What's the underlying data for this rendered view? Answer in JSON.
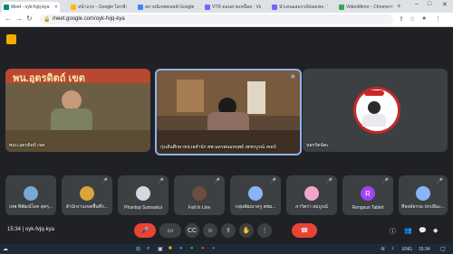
{
  "browser": {
    "tabs": [
      {
        "title": "Meet - oyk-fvjq-kya",
        "fav": "#00897b",
        "active": true
      },
      {
        "title": "หน้าแรก - Google ไดรฟ์",
        "fav": "#fbbc04",
        "active": false
      },
      {
        "title": "สถานนิเทศคอมพ์ Google",
        "fav": "#4285f4",
        "active": false
      },
      {
        "title": "VTR ดอนย่ายเหนื่อย - Video",
        "fav": "#7b61ff",
        "active": false
      },
      {
        "title": "นำเสนอสมรรถ์ย่อยเพจ - Video",
        "fav": "#7b61ff",
        "active": false
      },
      {
        "title": "VideoMirror - Chrome",
        "fav": "#34a853",
        "active": false
      }
    ],
    "url": "meet.google.com/oyk-fvjq-kya",
    "window_controls": [
      "–",
      "□",
      "✕"
    ]
  },
  "meet": {
    "main_tiles": [
      {
        "name": "พนบ.อุตรดิตถ์ เขต",
        "banner": "พน.อุตรดิตถ์ เขต"
      },
      {
        "name": "กุ่งเส้นศึกษาหน่วยสำนัก ศพ.นครพนมหฤพธ์ เพชรบูรณ์ เขต3"
      },
      {
        "name": "นพรรัตน์ตะ"
      }
    ],
    "bottom_tiles": [
      {
        "name": "เทพ พิพัฒน์โยค สุดๆ...",
        "avatar_color": "#7aa7d6",
        "letter": ""
      },
      {
        "name": "สำนักงานเขตพื้นที่ก...",
        "avatar_color": "#d9a43b",
        "letter": ""
      },
      {
        "name": "Phanlop Sumsakul",
        "avatar_color": "#cfd8e3",
        "letter": ""
      },
      {
        "name": "Fall In Line",
        "avatar_color": "#6d4c41",
        "letter": ""
      },
      {
        "name": "กลุ่มพัฒนาครู สพม...",
        "avatar_color": "#8ab4f8",
        "letter": ""
      },
      {
        "name": "ภาวิตรา สมบูรณ์",
        "avatar_color": "#f0a6ca",
        "letter": ""
      },
      {
        "name": "Rengsun Tablet",
        "avatar_color": "#a142f4",
        "letter": "R"
      },
      {
        "name": "ทีพงษ์ธรรม ปกปลีมะ...",
        "avatar_color": "#8ab4f8",
        "letter": ""
      }
    ]
  },
  "controls": {
    "time": "15:34",
    "separator": "|",
    "meeting_code": "oyk-fvjq-kya"
  },
  "taskbar": {
    "lang": "ENG",
    "clock": "15:34"
  }
}
